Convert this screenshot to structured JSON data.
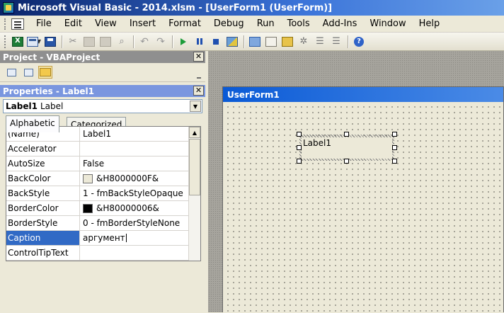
{
  "window": {
    "title": "Microsoft Visual Basic - 2014.xlsm - [UserForm1 (UserForm)]"
  },
  "menu": [
    {
      "id": "file",
      "label": "File"
    },
    {
      "id": "edit",
      "label": "Edit"
    },
    {
      "id": "view",
      "label": "View"
    },
    {
      "id": "insert",
      "label": "Insert"
    },
    {
      "id": "format",
      "label": "Format"
    },
    {
      "id": "debug",
      "label": "Debug"
    },
    {
      "id": "run",
      "label": "Run"
    },
    {
      "id": "tools",
      "label": "Tools"
    },
    {
      "id": "addins",
      "label": "Add-Ins"
    },
    {
      "id": "window",
      "label": "Window"
    },
    {
      "id": "help",
      "label": "Help"
    }
  ],
  "toolbar": {
    "icons": [
      "excel-icon",
      "insert-userform-icon",
      "save-icon",
      "cut-icon",
      "copy-icon",
      "paste-icon",
      "find-icon",
      "undo-icon",
      "redo-icon",
      "run-icon",
      "break-icon",
      "reset-icon",
      "design-mode-icon",
      "project-explorer-icon",
      "properties-window-icon",
      "object-browser-icon",
      "toolbox-icon",
      "indent-icon",
      "outdent-icon",
      "help-icon"
    ]
  },
  "project_panel": {
    "title": "Project - VBAProject",
    "close_label": "✕"
  },
  "properties_panel": {
    "title": "Properties - Label1",
    "close_label": "✕",
    "object_name": "Label1",
    "object_type": "Label",
    "tabs": [
      {
        "id": "alphabetic",
        "label": "Alphabetic",
        "active": true
      },
      {
        "id": "categorized",
        "label": "Categorized",
        "active": false
      }
    ],
    "rows": [
      {
        "name": "(Name)",
        "value": "Label1",
        "swatch": null,
        "selected": false
      },
      {
        "name": "Accelerator",
        "value": "",
        "swatch": null,
        "selected": false
      },
      {
        "name": "AutoSize",
        "value": "False",
        "swatch": null,
        "selected": false
      },
      {
        "name": "BackColor",
        "value": "&H8000000F&",
        "swatch": "#ece9d8",
        "selected": false
      },
      {
        "name": "BackStyle",
        "value": "1 - fmBackStyleOpaque",
        "swatch": null,
        "selected": false
      },
      {
        "name": "BorderColor",
        "value": "&H80000006&",
        "swatch": "#000000",
        "selected": false
      },
      {
        "name": "BorderStyle",
        "value": "0 - fmBorderStyleNone",
        "swatch": null,
        "selected": false
      },
      {
        "name": "Caption",
        "value": "аргумент",
        "swatch": null,
        "selected": true
      },
      {
        "name": "ControlTipText",
        "value": "",
        "swatch": null,
        "selected": false
      }
    ]
  },
  "form_designer": {
    "form_title": "UserForm1",
    "label_caption": "Label1"
  },
  "colors": {
    "selection": "#316ac5",
    "form_title": "#0a5ad6",
    "panel_title": "#7a96df"
  }
}
